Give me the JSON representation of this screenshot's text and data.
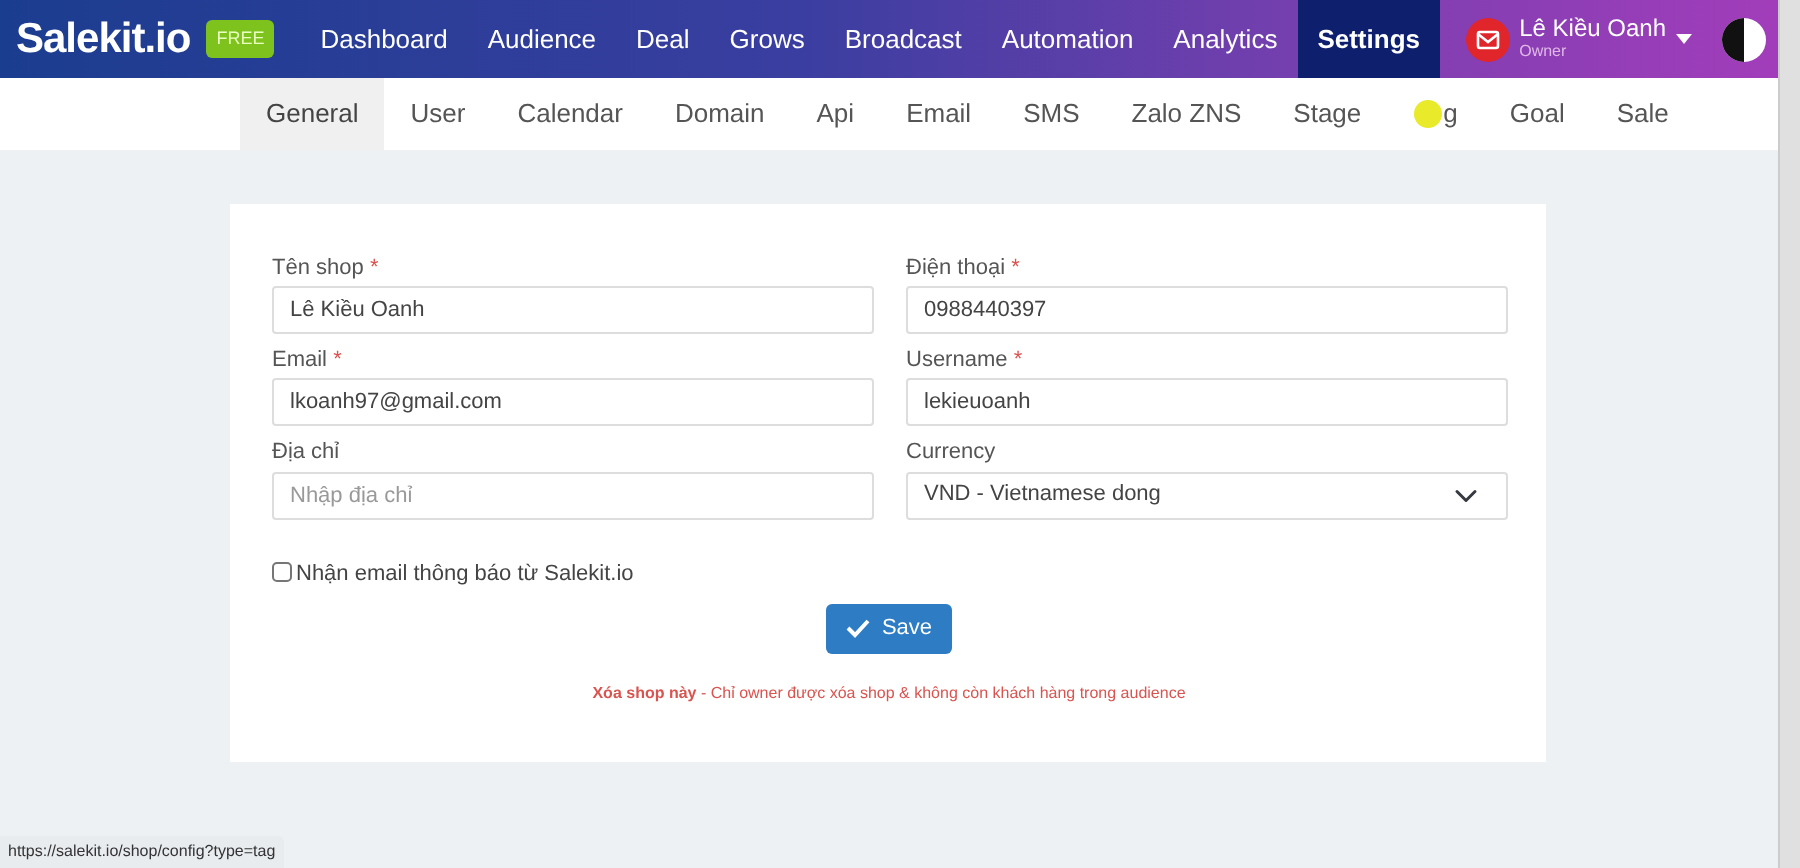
{
  "brand": {
    "logo": "Salekit.io",
    "plan": "FREE"
  },
  "nav": [
    {
      "label": "Dashboard",
      "selected": false
    },
    {
      "label": "Audience",
      "selected": false
    },
    {
      "label": "Deal",
      "selected": false
    },
    {
      "label": "Grows",
      "selected": false
    },
    {
      "label": "Broadcast",
      "selected": false
    },
    {
      "label": "Automation",
      "selected": false
    },
    {
      "label": "Analytics",
      "selected": false
    },
    {
      "label": "Settings",
      "selected": true
    }
  ],
  "user": {
    "name": "Lê Kiều Oanh",
    "role": "Owner"
  },
  "tabs": [
    {
      "label": "General",
      "selected": true
    },
    {
      "label": "User",
      "selected": false
    },
    {
      "label": "Calendar",
      "selected": false
    },
    {
      "label": "Domain",
      "selected": false
    },
    {
      "label": "Api",
      "selected": false
    },
    {
      "label": "Email",
      "selected": false
    },
    {
      "label": "SMS",
      "selected": false
    },
    {
      "label": "Zalo ZNS",
      "selected": false
    },
    {
      "label": "Stage",
      "selected": false
    },
    {
      "label": "g",
      "selected": false,
      "pointer": true
    },
    {
      "label": "Goal",
      "selected": false
    },
    {
      "label": "Sale",
      "selected": false
    }
  ],
  "form": {
    "fields": [
      {
        "kind": "text",
        "label": "Tên shop",
        "required_mark": "*",
        "value": "Lê Kiều Oanh"
      },
      {
        "kind": "text",
        "label": "Điện thoại",
        "required_mark": "*",
        "value": "0988440397"
      },
      {
        "kind": "text",
        "label": "Email",
        "required_mark": "*",
        "value": "lkoanh97@gmail.com"
      },
      {
        "kind": "text",
        "label": "Username",
        "required_mark": "*",
        "value": "lekieuoanh"
      },
      {
        "kind": "text",
        "label": "Địa chỉ",
        "placeholder": "Nhập địa chỉ"
      },
      {
        "kind": "select",
        "label": "Currency",
        "value": "VND - Vietnamese dong"
      }
    ],
    "checkbox": {
      "label": "Nhận email thông báo từ Salekit.io",
      "checked": false
    },
    "save_button": "Save",
    "delete_note": "**Xóa shop này** - Chỉ owner được xóa shop & không còn khách hàng trong audience"
  },
  "status_bar": "https://salekit.io/shop/config?type=tag"
}
